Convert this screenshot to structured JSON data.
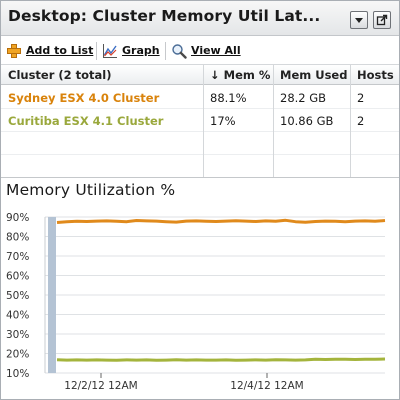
{
  "window": {
    "title": "Desktop: Cluster Memory Util Lat..."
  },
  "toolbar": {
    "add_label": "Add to List",
    "graph_label": "Graph",
    "view_all_label": "View All"
  },
  "table": {
    "headers": {
      "cluster": "Cluster (2 total)",
      "mem_pct": "↓ Mem %",
      "mem_used": "Mem Used",
      "hosts": "Hosts"
    },
    "rows": [
      {
        "cluster": "Sydney ESX 4.0 Cluster",
        "mem_pct": "88.1%",
        "mem_used": "28.2 GB",
        "hosts": "2",
        "color": "#d9830c"
      },
      {
        "cluster": "Curitiba ESX 4.1 Cluster",
        "mem_pct": "17%",
        "mem_used": "10.86 GB",
        "hosts": "2",
        "color": "#9aa83c"
      }
    ]
  },
  "chart_title": "Memory Utilization %",
  "chart_data": {
    "type": "line",
    "title": "Memory Utilization %",
    "ylim": [
      10,
      90
    ],
    "yticks": [
      "90%",
      "80%",
      "70%",
      "60%",
      "50%",
      "40%",
      "30%",
      "20%",
      "10%"
    ],
    "xticks": [
      "12/2/12 12AM",
      "12/4/12 12AM"
    ],
    "grid": true,
    "series": [
      {
        "color": "#e08a1c",
        "values": [
          87.2,
          87.6,
          87.8,
          87.7,
          87.9,
          88.0,
          87.8,
          87.6,
          88.2,
          88.0,
          87.9,
          87.6,
          87.4,
          87.9,
          88.0,
          87.8,
          87.7,
          87.9,
          88.1,
          87.9,
          87.7,
          88.0,
          87.8,
          88.3,
          87.6,
          87.3,
          87.7,
          87.9,
          87.8,
          87.6,
          87.9,
          88.0,
          87.8,
          88.2
        ]
      },
      {
        "color": "#a4b43c",
        "values": [
          16.8,
          16.6,
          16.7,
          16.6,
          16.7,
          16.6,
          16.5,
          16.7,
          16.6,
          16.7,
          16.5,
          16.6,
          16.8,
          16.6,
          16.7,
          16.6,
          16.6,
          16.7,
          16.5,
          16.6,
          16.7,
          16.6,
          16.8,
          16.7,
          16.6,
          16.7,
          17.0,
          16.9,
          17.1,
          17.0,
          16.9,
          17.1,
          17.0,
          17.2
        ]
      }
    ]
  }
}
